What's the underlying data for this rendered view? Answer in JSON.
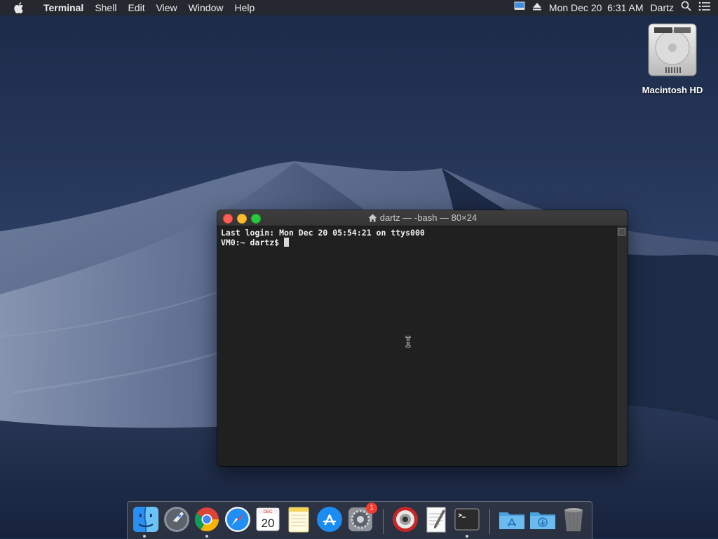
{
  "menubar": {
    "app_name": "Terminal",
    "menus": [
      "Shell",
      "Edit",
      "View",
      "Window",
      "Help"
    ],
    "datetime": "Mon Dec 20  6:31 AM",
    "user": "Dartz"
  },
  "desktop": {
    "disk_label": "Macintosh HD"
  },
  "terminal": {
    "title": "dartz — -bash — 80×24",
    "lines": [
      "Last login: Mon Dec 20 05:54:21 on ttys000",
      "VM0:~ dartz$ "
    ]
  },
  "dock": {
    "items": [
      {
        "name": "finder",
        "icon": "finder-icon",
        "running": true
      },
      {
        "name": "launchpad",
        "icon": "rocket-icon",
        "running": false
      },
      {
        "name": "chrome",
        "icon": "chrome-icon",
        "running": true
      },
      {
        "name": "safari",
        "icon": "compass-icon",
        "running": false
      },
      {
        "name": "calendar",
        "icon": "calendar-icon",
        "running": false
      },
      {
        "name": "notes",
        "icon": "notes-icon",
        "running": false
      },
      {
        "name": "app-store",
        "icon": "app-store-icon",
        "running": false
      },
      {
        "name": "system-preferences",
        "icon": "gear-icon",
        "running": false,
        "badge": "1"
      },
      {
        "name": "photo-booth",
        "icon": "camera-icon",
        "running": false
      },
      {
        "name": "textedit",
        "icon": "document-icon",
        "running": false
      },
      {
        "name": "terminal",
        "icon": "terminal-icon",
        "running": true
      },
      {
        "name": "applications-folder",
        "icon": "applications-folder-icon",
        "running": false
      },
      {
        "name": "downloads-folder",
        "icon": "downloads-folder-icon",
        "running": false
      },
      {
        "name": "trash",
        "icon": "trash-icon",
        "running": false
      }
    ],
    "calendar_month": "DEC",
    "calendar_day": "20",
    "sys_prefs_badge": "1"
  },
  "colors": {
    "accent_close": "#fe5f57",
    "accent_min": "#febc2e",
    "accent_max": "#28c840",
    "terminal_bg": "#202020"
  }
}
